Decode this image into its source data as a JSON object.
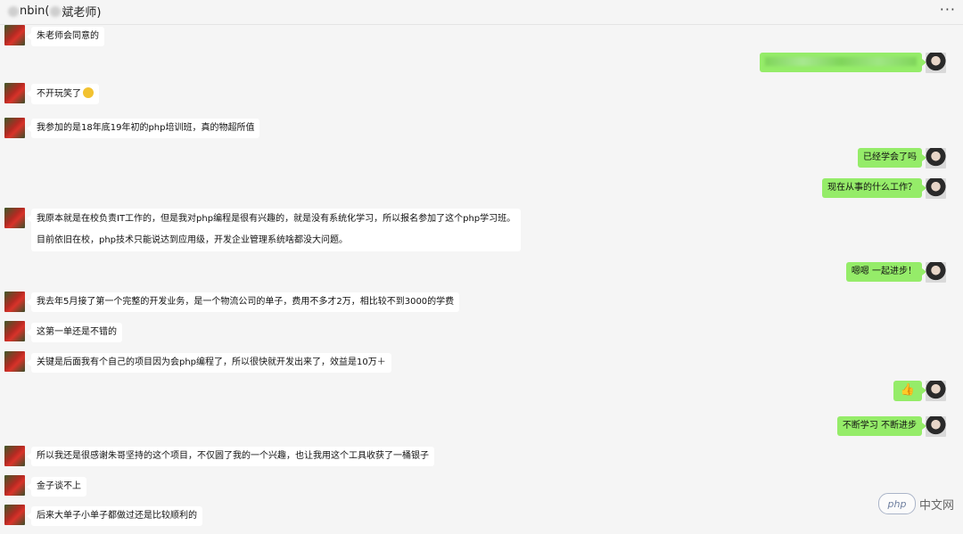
{
  "header": {
    "title_prefix": "nbin(",
    "title_suffix": "斌老师)",
    "more": "···"
  },
  "messages": [
    {
      "side": "in",
      "text": "朱老师会同意的"
    },
    {
      "side": "out",
      "text": ""
    },
    {
      "side": "in",
      "text": "不开玩笑了"
    },
    {
      "side": "in",
      "text": "我参加的是18年底19年初的php培训班，真的物超所值"
    },
    {
      "side": "out",
      "text": "已经学会了吗"
    },
    {
      "side": "out",
      "text": "现在从事的什么工作？"
    },
    {
      "side": "in",
      "text": "我原本就是在校负责IT工作的，但是我对php编程是很有兴趣的，就是没有系统化学习，所以报名参加了这个php学习班。",
      "text2": "目前依旧在校，php技术只能说达到应用级，开发企业管理系统啥都没大问题。"
    },
    {
      "side": "out",
      "text": "嗯嗯  一起进步！"
    },
    {
      "side": "in",
      "text": "我去年5月接了第一个完整的开发业务，是一个物流公司的单子，费用不多才2万，相比较不到3000的学费"
    },
    {
      "side": "in",
      "text": "这第一单还是不错的"
    },
    {
      "side": "in",
      "text": "关键是后面我有个自己的项目因为会php编程了，所以很快就开发出来了，效益是10万＋"
    },
    {
      "side": "out",
      "text": "👍"
    },
    {
      "side": "out",
      "text": "不断学习  不断进步"
    },
    {
      "side": "in",
      "text": "所以我还是很感谢朱哥坚持的这个项目，不仅圆了我的一个兴趣，也让我用这个工具收获了一桶银子"
    },
    {
      "side": "in",
      "text": "金子谈不上"
    },
    {
      "side": "in",
      "text": "后来大单子小单子都做过还是比较顺利的"
    }
  ],
  "watermark": {
    "logo": "php",
    "text": "中文网"
  },
  "colors": {
    "outgoing_bubble": "#95ec69",
    "incoming_bubble": "#ffffff",
    "background": "#f5f5f5"
  }
}
